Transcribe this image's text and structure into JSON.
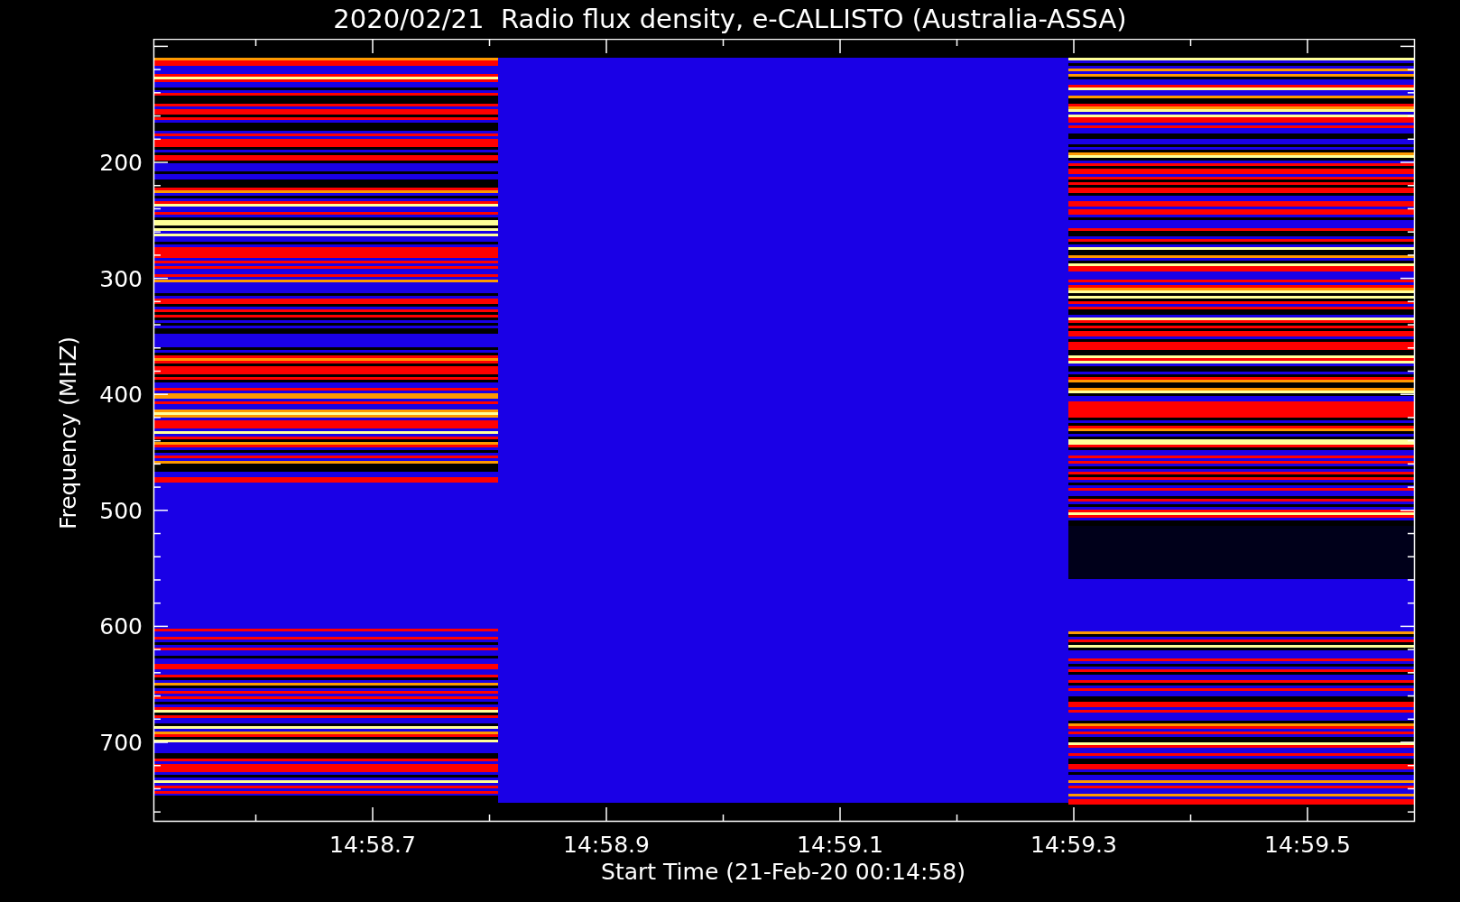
{
  "title": "2020/02/21  Radio flux density, e-CALLISTO (Australia-ASSA)",
  "y_axis": {
    "label": "Frequency (MHZ)",
    "ticks": [
      "200",
      "300",
      "400",
      "500",
      "600",
      "700"
    ]
  },
  "x_axis": {
    "label": "Start Time (21-Feb-20 00:14:58)",
    "ticks": [
      "14:58.7",
      "14:58.9",
      "14:59.1",
      "14:59.3",
      "14:59.5"
    ]
  }
}
